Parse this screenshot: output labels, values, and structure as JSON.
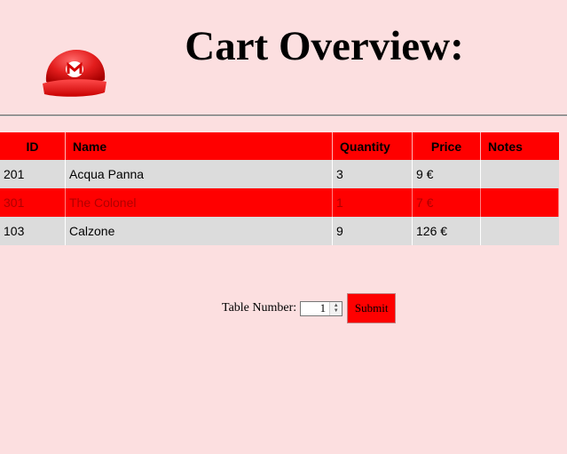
{
  "header": {
    "title": "Cart Overview:",
    "logo_icon": "mario-cap-icon"
  },
  "table": {
    "columns": [
      "ID",
      "Name",
      "Quantity",
      "Price",
      "Notes"
    ],
    "rows": [
      {
        "id": "201",
        "name": "Acqua Panna",
        "quantity": "3",
        "price": "9 €",
        "notes": ""
      },
      {
        "id": "301",
        "name": "The Colonel",
        "quantity": "1",
        "price": "7 €",
        "notes": ""
      },
      {
        "id": "103",
        "name": "Calzone",
        "quantity": "9",
        "price": "126 €",
        "notes": ""
      }
    ]
  },
  "form": {
    "label": "Table Number:",
    "table_number": "1",
    "submit_label": "Submit"
  },
  "colors": {
    "background": "#fcdfe0",
    "accent": "#ff0000",
    "row_grey": "#dcdcdc"
  }
}
